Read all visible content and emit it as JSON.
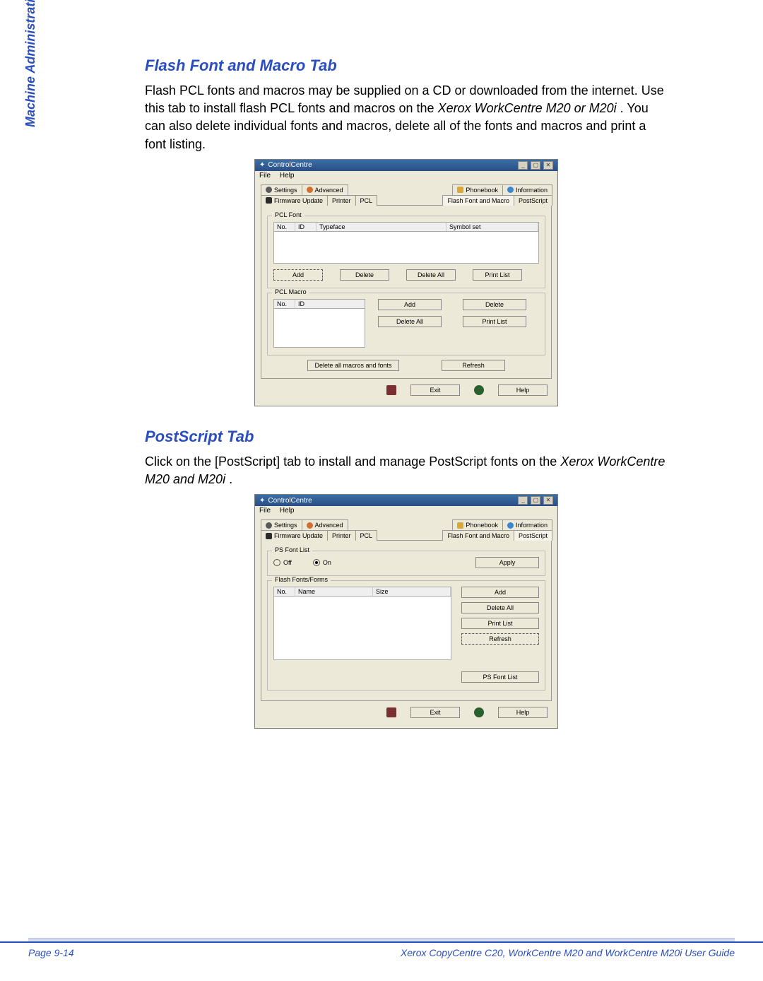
{
  "sidebar_label": "Machine Administration",
  "section1": {
    "title": "Flash Font and Macro Tab",
    "para_a": "Flash PCL fonts and macros may be supplied on a CD or downloaded from the internet. Use this tab to install flash PCL fonts and macros on the ",
    "para_b_ital": "Xerox WorkCentre M20 or M20i",
    "para_c": ". You can also delete individual fonts and macros, delete all of the fonts and macros and print a font listing."
  },
  "section2": {
    "title": "PostScript Tab",
    "para_a": "Click on the [PostScript] tab to install and manage PostScript fonts on the ",
    "para_b_ital": "Xerox WorkCentre M20 and M20i",
    "para_c": "."
  },
  "app": {
    "title": "ControlCentre",
    "menu": {
      "file": "File",
      "help": "Help"
    },
    "tabs": {
      "settings": "Settings",
      "advanced": "Advanced",
      "phonebook": "Phonebook",
      "information": "Information",
      "firmware": "Firmware Update",
      "printer": "Printer",
      "pcl": "PCL",
      "flash_font_macro": "Flash Font and Macro",
      "postscript": "PostScript"
    },
    "groups": {
      "pcl_font": "PCL Font",
      "pcl_macro": "PCL Macro",
      "ps_font_list": "PS Font List",
      "flash_fonts_forms": "Flash Fonts/Forms"
    },
    "cols": {
      "no": "No.",
      "id": "ID",
      "typeface": "Typeface",
      "symbolset": "Symbol set",
      "name": "Name",
      "size": "Size"
    },
    "buttons": {
      "add": "Add",
      "delete": "Delete",
      "delete_all": "Delete All",
      "print_list": "Print List",
      "delete_all_macros_fonts": "Delete all macros and fonts",
      "refresh": "Refresh",
      "apply": "Apply",
      "ps_font_list": "PS Font List",
      "exit": "Exit",
      "help": "Help"
    },
    "radio": {
      "off": "Off",
      "on": "On"
    }
  },
  "footer": {
    "page": "Page 9-14",
    "guide": "Xerox CopyCentre C20, WorkCentre M20 and WorkCentre M20i User Guide"
  }
}
